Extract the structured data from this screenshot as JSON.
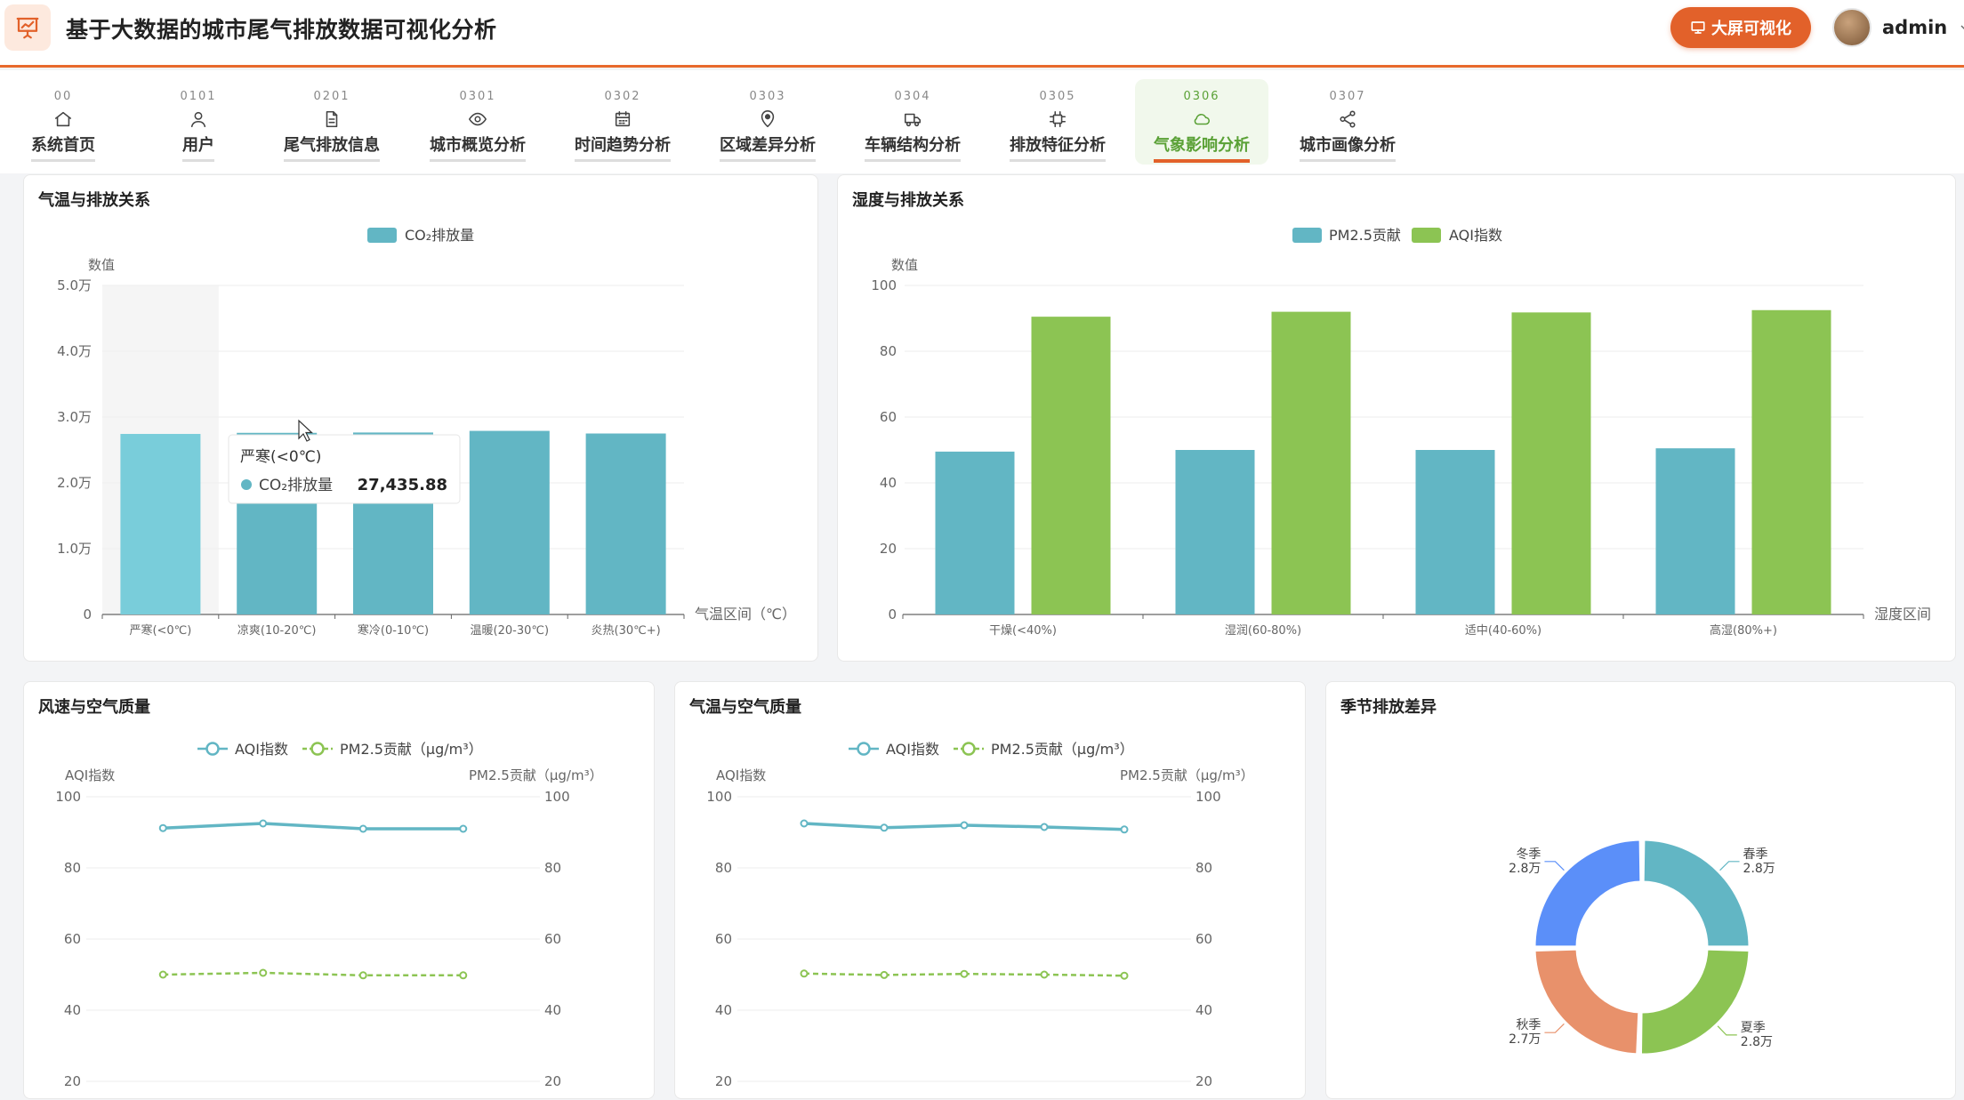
{
  "header": {
    "title": "基于大数据的城市尾气排放数据可视化分析",
    "bigscreen_label": "大屏可视化",
    "user_name": "admin"
  },
  "nav": [
    {
      "code": "00",
      "label": "系统首页",
      "icon": "home-icon"
    },
    {
      "code": "0101",
      "label": "用户",
      "icon": "user-icon"
    },
    {
      "code": "0201",
      "label": "尾气排放信息",
      "icon": "document-icon"
    },
    {
      "code": "0301",
      "label": "城市概览分析",
      "icon": "eye-icon"
    },
    {
      "code": "0302",
      "label": "时间趋势分析",
      "icon": "calendar-icon"
    },
    {
      "code": "0303",
      "label": "区域差异分析",
      "icon": "location-pin-icon"
    },
    {
      "code": "0304",
      "label": "车辆结构分析",
      "icon": "truck-icon"
    },
    {
      "code": "0305",
      "label": "排放特征分析",
      "icon": "chip-icon"
    },
    {
      "code": "0306",
      "label": "气象影响分析",
      "icon": "cloud-icon",
      "active": true
    },
    {
      "code": "0307",
      "label": "城市画像分析",
      "icon": "share-icon"
    }
  ],
  "panels": {
    "temp_emission": {
      "title": "气温与排放关系"
    },
    "humidity_emission": {
      "title": "湿度与排放关系"
    },
    "wind_air": {
      "title": "风速与空气质量"
    },
    "temp_air": {
      "title": "气温与空气质量"
    },
    "season": {
      "title": "季节排放差异"
    }
  },
  "tooltip": {
    "title": "严寒(<0℃)",
    "series": "CO₂排放量",
    "value": "27,435.88"
  },
  "colors": {
    "accent": "#e2612a",
    "teal": "#62b6c4",
    "teal_light": "#79cdda",
    "green": "#8cc453",
    "blue": "#5b8ff9",
    "salmon": "#e8916b"
  },
  "chart_data": [
    {
      "id": "temp_emission",
      "type": "bar",
      "categories": [
        "严寒(<0℃)",
        "凉爽(10-20℃)",
        "寒冷(0-10℃)",
        "温暖(20-30℃)",
        "炎热(30℃+)"
      ],
      "series": [
        {
          "name": "CO₂排放量",
          "values": [
            27435.88,
            27600,
            27650,
            27900,
            27500
          ]
        }
      ],
      "xlabel": "气温区间（℃）",
      "ylabel": "数值",
      "ylim": [
        0,
        50000
      ],
      "yticks": [
        "0",
        "1.0万",
        "2.0万",
        "3.0万",
        "4.0万",
        "5.0万"
      ],
      "legend": "top-center",
      "grid": true
    },
    {
      "id": "humidity_emission",
      "type": "bar",
      "categories": [
        "干燥(<40%)",
        "湿润(60-80%)",
        "适中(40-60%)",
        "高湿(80%+)"
      ],
      "series": [
        {
          "name": "PM2.5贡献",
          "values": [
            49.5,
            50,
            50,
            50.5
          ]
        },
        {
          "name": "AQI指数",
          "values": [
            90.5,
            92,
            91.8,
            92.5
          ]
        }
      ],
      "xlabel": "湿度区间",
      "ylabel": "数值",
      "ylim": [
        0,
        100
      ],
      "yticks": [
        "0",
        "20",
        "40",
        "60",
        "80",
        "100"
      ],
      "legend": "top-center",
      "grid": true
    },
    {
      "id": "wind_air",
      "type": "line",
      "series": [
        {
          "name": "AQI指数",
          "values": [
            91.2,
            92.5,
            91.0,
            91.0
          ]
        },
        {
          "name": "PM2.5贡献（μg/m³）",
          "values": [
            50.0,
            50.5,
            49.8,
            49.8
          ]
        }
      ],
      "ylabel": "AQI指数",
      "ylabel_right": "PM2.5贡献（μg/m³）",
      "ylim": [
        0,
        100
      ],
      "yticks_visible": [
        "20",
        "40",
        "60",
        "80",
        "100"
      ],
      "legend": "top-center",
      "grid": true
    },
    {
      "id": "temp_air",
      "type": "line",
      "series": [
        {
          "name": "AQI指数",
          "values": [
            92.5,
            91.3,
            92.0,
            91.5,
            90.8
          ]
        },
        {
          "name": "PM2.5贡献（μg/m³）",
          "values": [
            50.3,
            49.9,
            50.2,
            50.0,
            49.7
          ]
        }
      ],
      "ylabel": "AQI指数",
      "ylabel_right": "PM2.5贡献（μg/m³）",
      "ylim": [
        0,
        100
      ],
      "yticks_visible": [
        "20",
        "40",
        "60",
        "80",
        "100"
      ],
      "legend": "top-center",
      "grid": true
    },
    {
      "id": "season",
      "type": "pie",
      "donut": true,
      "slices": [
        {
          "name": "春季",
          "value": 28000,
          "label": "2.8万"
        },
        {
          "name": "夏季",
          "value": 28000,
          "label": "2.8万"
        },
        {
          "name": "秋季",
          "value": 27000,
          "label": "2.7万"
        },
        {
          "name": "冬季",
          "value": 28000,
          "label": "2.8万"
        }
      ]
    }
  ]
}
